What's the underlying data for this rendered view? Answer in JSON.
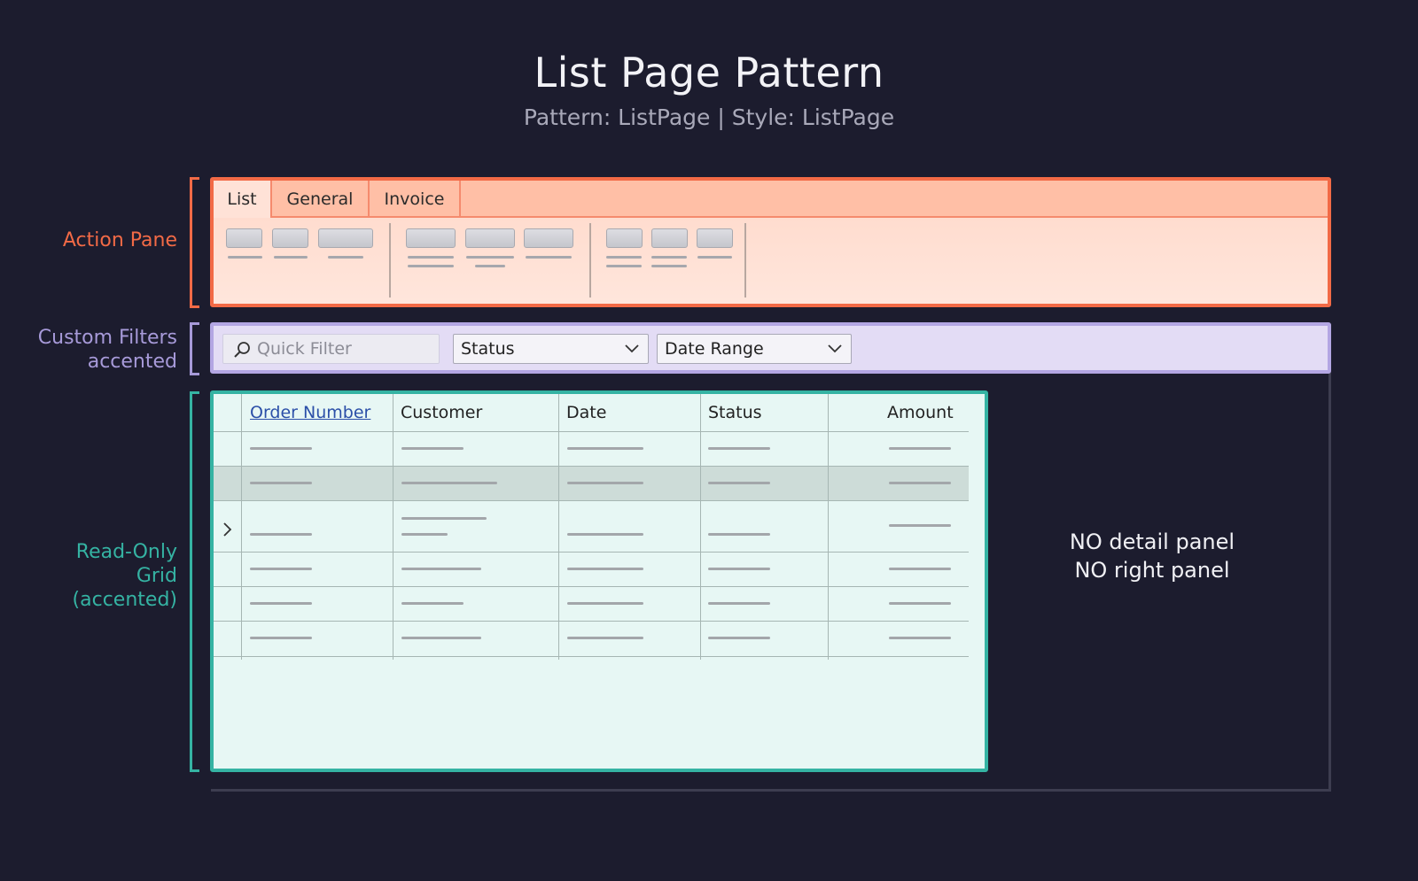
{
  "header": {
    "title": "List Page Pattern",
    "subtitle": "Pattern: ListPage | Style: ListPage"
  },
  "labels": {
    "action_pane": "Action Pane",
    "custom_filters_line1": "Custom Filters",
    "custom_filters_line2": "accented",
    "grid_line1": "Read-Only",
    "grid_line2": "Grid",
    "grid_line3": "(accented)"
  },
  "action_pane": {
    "tabs": [
      "List",
      "General",
      "Invoice"
    ],
    "active_tab": "List"
  },
  "filters": {
    "quick_filter_placeholder": "Quick Filter",
    "status_label": "Status",
    "date_range_label": "Date Range"
  },
  "grid": {
    "columns": [
      "Order Number",
      "Customer",
      "Date",
      "Status",
      "Amount"
    ],
    "sortable_column": "Order Number",
    "row_count": 6,
    "highlighted_row": 2,
    "current_row": 3
  },
  "notes": {
    "line1": "NO detail panel",
    "line2": "NO right panel"
  },
  "colors": {
    "background": "#1c1c2e",
    "action_accent": "#f26a46",
    "filters_accent": "#a79ad9",
    "grid_accent": "#35b3a3"
  }
}
